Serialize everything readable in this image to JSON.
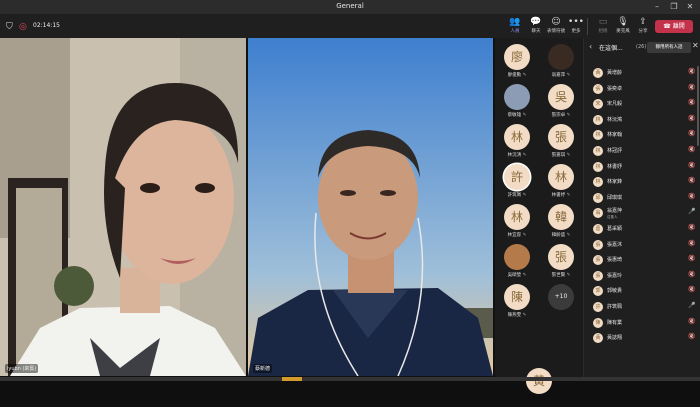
{
  "window": {
    "title": "General",
    "controls": [
      "–",
      "❐",
      "✕"
    ]
  },
  "toolbar": {
    "timer": "02:14:15",
    "buttons": [
      {
        "id": "people",
        "label": "人員",
        "glyph": "👥",
        "active": true
      },
      {
        "id": "chat",
        "label": "聊天",
        "glyph": "💬"
      },
      {
        "id": "react",
        "label": "表情符號",
        "glyph": "☺"
      },
      {
        "id": "more",
        "label": "更多",
        "glyph": "•••"
      },
      {
        "id": "camera",
        "label": "相機",
        "glyph": "▭",
        "dim": true
      },
      {
        "id": "mic",
        "label": "麥克風",
        "glyph": "🎙"
      },
      {
        "id": "share",
        "label": "分享",
        "glyph": "⇪"
      }
    ],
    "leave": "離開"
  },
  "stage": {
    "left_name": "lyubn (來賓)",
    "right_name": "蔡新德"
  },
  "gallery": {
    "cells": [
      {
        "char": "廖",
        "name": "廖俊勳",
        "photo": false
      },
      {
        "char": "",
        "name": "翁嘉萍",
        "photo": true,
        "bg": "#3a2b22"
      },
      {
        "char": "",
        "name": "蔡敏雄",
        "photo": true,
        "bg": "#8b9cb4"
      },
      {
        "char": "吳",
        "name": "張宗卓",
        "photo": false
      },
      {
        "char": "林",
        "name": "林沅鴻",
        "photo": false
      },
      {
        "char": "張",
        "name": "張嘉琪",
        "photo": false
      },
      {
        "char": "許",
        "name": "許筑珮",
        "photo": false,
        "ring": true
      },
      {
        "char": "林",
        "name": "林書妤",
        "photo": false
      },
      {
        "char": "林",
        "name": "林宜容",
        "photo": false
      },
      {
        "char": "韓",
        "name": "韓齡盛",
        "photo": false
      },
      {
        "char": "",
        "name": "吳碩瑩",
        "photo": true,
        "bg": "#b57a4a"
      },
      {
        "char": "張",
        "name": "張世賢",
        "photo": false
      },
      {
        "char": "陳",
        "name": "陳燕雯",
        "photo": false
      },
      {
        "char": "",
        "name": "",
        "more": "+10"
      },
      {
        "char": "黃",
        "name": "",
        "photo": false
      }
    ]
  },
  "panel": {
    "title": "在這個...",
    "count": "(26)",
    "mute_all": "靜用所有人話",
    "people": [
      {
        "char": "黃",
        "name": "黃增齡",
        "mic": "muted"
      },
      {
        "char": "張",
        "name": "張奕卓",
        "mic": "muted"
      },
      {
        "char": "宋",
        "name": "宋凡毅",
        "mic": "muted"
      },
      {
        "char": "林",
        "name": "林沅鴻",
        "mic": "muted"
      },
      {
        "char": "林",
        "name": "林家翰",
        "mic": "muted"
      },
      {
        "char": "林",
        "name": "林冠評",
        "mic": "muted"
      },
      {
        "char": "林",
        "name": "林書妤",
        "mic": "muted"
      },
      {
        "char": "林",
        "name": "林家鋒",
        "mic": "muted"
      },
      {
        "char": "邱",
        "name": "邱琪琪",
        "mic": "muted"
      },
      {
        "char": "翁",
        "name": "翁嘉萍",
        "sub": "召集人",
        "mic": "on"
      },
      {
        "char": "葛",
        "name": "葛采穎",
        "mic": "muted"
      },
      {
        "char": "張",
        "name": "張嘉沐",
        "mic": "muted"
      },
      {
        "char": "張",
        "name": "張惠琦",
        "mic": "muted"
      },
      {
        "char": "張",
        "name": "張嘉玲",
        "mic": "muted"
      },
      {
        "char": "郭",
        "name": "郭敏貴",
        "mic": "muted"
      },
      {
        "char": "許",
        "name": "許筑珮",
        "mic": "on"
      },
      {
        "char": "陳",
        "name": "陳有業",
        "mic": "muted"
      },
      {
        "char": "黃",
        "name": "黃誌翔",
        "mic": "muted"
      }
    ]
  }
}
